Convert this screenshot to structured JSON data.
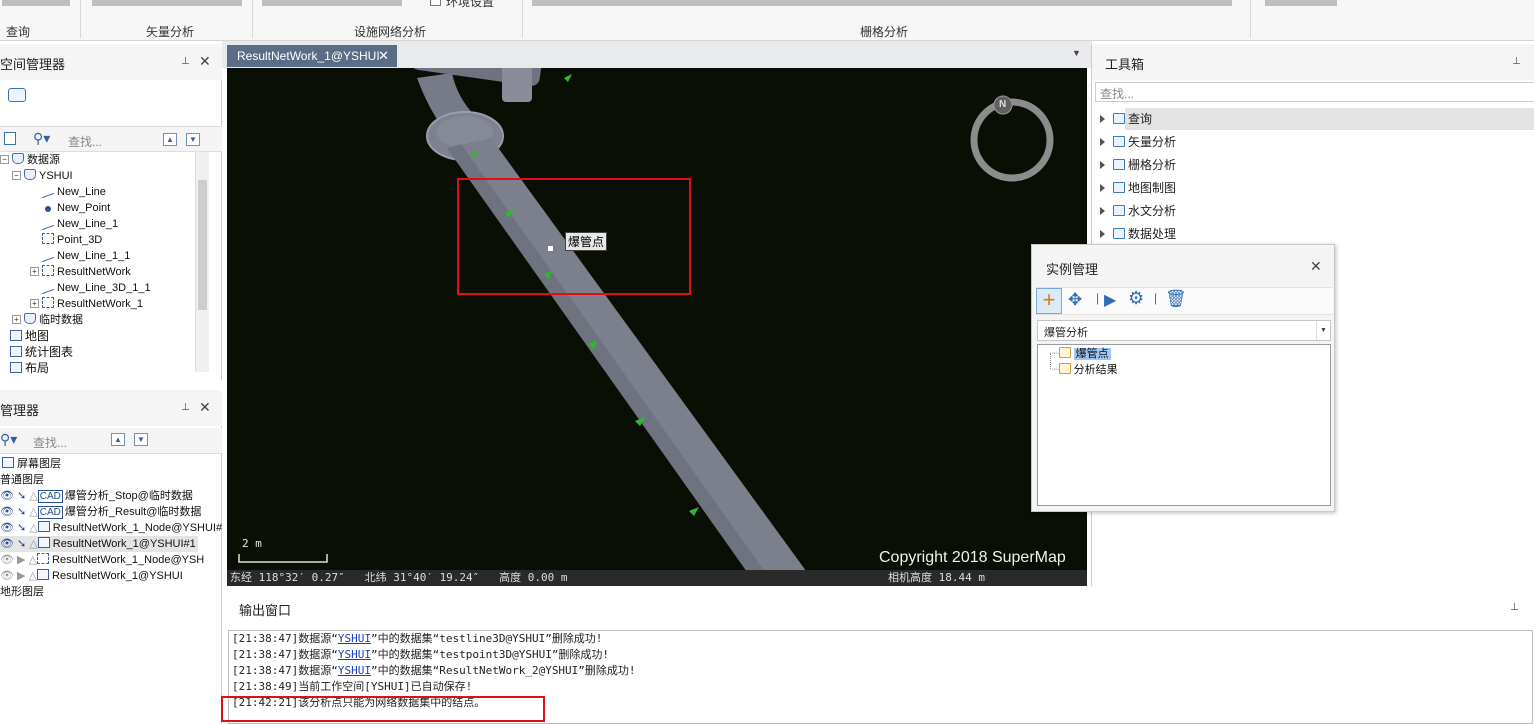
{
  "ribbon": {
    "groups": [
      {
        "label": "查询"
      },
      {
        "label": "矢量分析"
      },
      {
        "label": "设施网络分析"
      },
      {
        "label": "栅格分析"
      }
    ],
    "env_label": "环境设置"
  },
  "workspace_panel": {
    "title": "空间管理器",
    "search_placeholder": "查找...",
    "tree": {
      "datasource_root": "数据源",
      "ds_yshui": "YSHUI",
      "items": [
        "New_Line",
        "New_Point",
        "New_Line_1",
        "Point_3D",
        "New_Line_1_1",
        "ResultNetWork",
        "New_Line_3D_1_1",
        "ResultNetWork_1"
      ],
      "temp": "临时数据",
      "maps": "地图",
      "charts": "统计图表",
      "layouts": "布局"
    }
  },
  "layer_panel": {
    "title": "管理器",
    "search_placeholder": "查找...",
    "screen_layer": "屏幕图层",
    "normal_layer": "普通图层",
    "layers": [
      "爆管分析_Stop@临时数据",
      "爆管分析_Result@临时数据",
      "ResultNetWork_1_Node@YSHUI#",
      "ResultNetWork_1@YSHUI#1",
      "ResultNetWork_1_Node@YSH",
      "ResultNetWork_1@YSHUI"
    ],
    "terrain_layer": "地形图层"
  },
  "map": {
    "tab_label": "ResultNetWork_1@YSHUI",
    "tooltip": "爆管点",
    "scale_label": "2 m",
    "copyright": "Copyright 2018 SuperMap",
    "compass_label": "N",
    "status_left": "东经 118°32′ 0.27″   北纬 31°40′ 19.24″   高度 0.00 m",
    "status_right": "相机高度 18.44 m"
  },
  "toolbox": {
    "title": "工具箱",
    "search_placeholder": "查找...",
    "items": [
      "查询",
      "矢量分析",
      "栅格分析",
      "地图制图",
      "水文分析",
      "数据处理"
    ]
  },
  "instance_dialog": {
    "title": "实例管理",
    "selected": "爆管分析",
    "tree": [
      "爆管点",
      "分析结果"
    ]
  },
  "output": {
    "title": "输出窗口",
    "lines": [
      {
        "time": "[21:38:47]",
        "pre": "数据源“",
        "link": "YSHUI",
        "post": "”中的数据集“testline3D@YSHUI”删除成功!"
      },
      {
        "time": "[21:38:47]",
        "pre": "数据源“",
        "link": "YSHUI",
        "post": "”中的数据集“testpoint3D@YSHUI”删除成功!"
      },
      {
        "time": "[21:38:47]",
        "pre": "数据源“",
        "link": "YSHUI",
        "post": "”中的数据集“ResultNetWork_2@YSHUI”删除成功!"
      },
      {
        "time": "[21:38:49]",
        "pre": "当前工作空间[YSHUI]已自动保存!",
        "link": "",
        "post": ""
      },
      {
        "time": "[21:42:21]",
        "pre": "该分析点只能为网络数据集中的结点。",
        "link": "",
        "post": ""
      }
    ]
  },
  "colors": {
    "accent_red": "#e01010",
    "tab_blue": "#5b6c86",
    "pipe_gray": "#7c7f8c",
    "arrow_green": "#2fb82f"
  }
}
